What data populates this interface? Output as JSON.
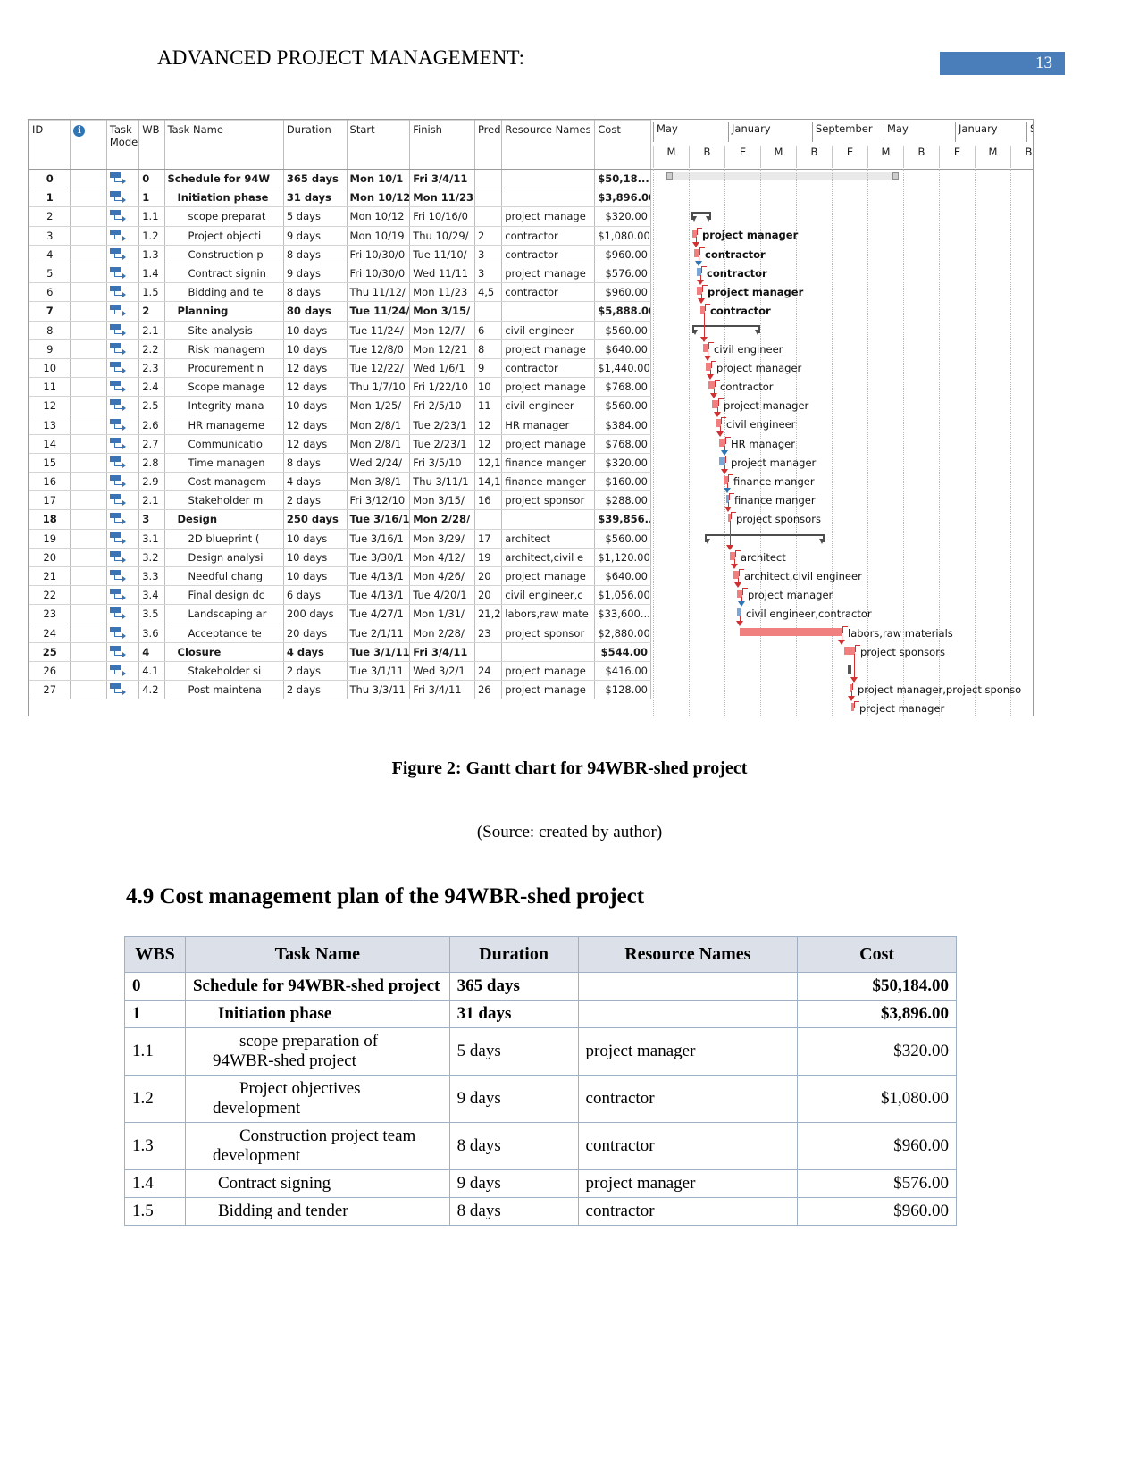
{
  "header": {
    "title": "ADVANCED PROJECT MANAGEMENT:",
    "page_number": "13",
    "badge_color": "#4A7EBB"
  },
  "gantt": {
    "columns": [
      "ID",
      "",
      "Task Mode",
      "WBS",
      "Task Name",
      "Duration",
      "Start",
      "Finish",
      "Pred",
      "Resource Names",
      "Cost"
    ],
    "column_labels": {
      "id": "ID",
      "info": "",
      "mode_line1": "Task",
      "mode_line2": "Mode",
      "wbs": "WB",
      "name": "Task Name",
      "duration": "Duration",
      "start": "Start",
      "finish": "Finish",
      "pred": "Pred",
      "resource": "Resource Names",
      "cost": "Cost"
    },
    "rows": [
      {
        "id": "0",
        "wbs": "0",
        "name": "Schedule for 94W",
        "duration": "365 days",
        "start": "Mon 10/1",
        "finish": "Fri 3/4/11",
        "pred": "",
        "resource": "",
        "cost": "$50,18...",
        "level": 0,
        "summary": true
      },
      {
        "id": "1",
        "wbs": "1",
        "name": "Initiation phase",
        "duration": "31 days",
        "start": "Mon 10/12",
        "finish": "Mon 11/23",
        "pred": "",
        "resource": "",
        "cost": "$3,896.00",
        "level": 1,
        "summary": true
      },
      {
        "id": "2",
        "wbs": "1.1",
        "name": "scope preparat",
        "duration": "5 days",
        "start": "Mon 10/12",
        "finish": "Fri 10/16/0",
        "pred": "",
        "resource": "project manage",
        "cost": "$320.00",
        "level": 2,
        "summary": false
      },
      {
        "id": "3",
        "wbs": "1.2",
        "name": "Project objecti",
        "duration": "9 days",
        "start": "Mon 10/19",
        "finish": "Thu 10/29/",
        "pred": "2",
        "resource": "contractor",
        "cost": "$1,080.00",
        "level": 2,
        "summary": false
      },
      {
        "id": "4",
        "wbs": "1.3",
        "name": "Construction p",
        "duration": "8 days",
        "start": "Fri 10/30/0",
        "finish": "Tue 11/10/",
        "pred": "3",
        "resource": "contractor",
        "cost": "$960.00",
        "level": 2,
        "summary": false
      },
      {
        "id": "5",
        "wbs": "1.4",
        "name": "Contract signin",
        "duration": "9 days",
        "start": "Fri 10/30/0",
        "finish": "Wed 11/11",
        "pred": "3",
        "resource": "project manage",
        "cost": "$576.00",
        "level": 2,
        "summary": false
      },
      {
        "id": "6",
        "wbs": "1.5",
        "name": "Bidding and te",
        "duration": "8 days",
        "start": "Thu 11/12/",
        "finish": "Mon 11/23",
        "pred": "4,5",
        "resource": "contractor",
        "cost": "$960.00",
        "level": 2,
        "summary": false
      },
      {
        "id": "7",
        "wbs": "2",
        "name": "Planning",
        "duration": "80 days",
        "start": "Tue 11/24/",
        "finish": "Mon 3/15/",
        "pred": "",
        "resource": "",
        "cost": "$5,888.00",
        "level": 1,
        "summary": true
      },
      {
        "id": "8",
        "wbs": "2.1",
        "name": "Site analysis",
        "duration": "10 days",
        "start": "Tue 11/24/",
        "finish": "Mon 12/7/",
        "pred": "6",
        "resource": "civil engineer",
        "cost": "$560.00",
        "level": 2,
        "summary": false
      },
      {
        "id": "9",
        "wbs": "2.2",
        "name": "Risk managem",
        "duration": "10 days",
        "start": "Tue 12/8/0",
        "finish": "Mon 12/21",
        "pred": "8",
        "resource": "project manage",
        "cost": "$640.00",
        "level": 2,
        "summary": false
      },
      {
        "id": "10",
        "wbs": "2.3",
        "name": "Procurement n",
        "duration": "12 days",
        "start": "Tue 12/22/",
        "finish": "Wed 1/6/1",
        "pred": "9",
        "resource": "contractor",
        "cost": "$1,440.00",
        "level": 2,
        "summary": false
      },
      {
        "id": "11",
        "wbs": "2.4",
        "name": "Scope manage",
        "duration": "12 days",
        "start": "Thu 1/7/10",
        "finish": "Fri 1/22/10",
        "pred": "10",
        "resource": "project manage",
        "cost": "$768.00",
        "level": 2,
        "summary": false
      },
      {
        "id": "12",
        "wbs": "2.5",
        "name": "Integrity mana",
        "duration": "10 days",
        "start": "Mon 1/25/",
        "finish": "Fri 2/5/10",
        "pred": "11",
        "resource": "civil engineer",
        "cost": "$560.00",
        "level": 2,
        "summary": false
      },
      {
        "id": "13",
        "wbs": "2.6",
        "name": "HR manageme",
        "duration": "12 days",
        "start": "Mon 2/8/1",
        "finish": "Tue 2/23/1",
        "pred": "12",
        "resource": "HR manager",
        "cost": "$384.00",
        "level": 2,
        "summary": false
      },
      {
        "id": "14",
        "wbs": "2.7",
        "name": "Communicatio",
        "duration": "12 days",
        "start": "Mon 2/8/1",
        "finish": "Tue 2/23/1",
        "pred": "12",
        "resource": "project manage",
        "cost": "$768.00",
        "level": 2,
        "summary": false
      },
      {
        "id": "15",
        "wbs": "2.8",
        "name": "Time managen",
        "duration": "8 days",
        "start": "Wed 2/24/",
        "finish": "Fri 3/5/10",
        "pred": "12,1",
        "resource": "finance manger",
        "cost": "$320.00",
        "level": 2,
        "summary": false
      },
      {
        "id": "16",
        "wbs": "2.9",
        "name": "Cost managem",
        "duration": "4 days",
        "start": "Mon 3/8/1",
        "finish": "Thu 3/11/1",
        "pred": "14,1",
        "resource": "finance manger",
        "cost": "$160.00",
        "level": 2,
        "summary": false
      },
      {
        "id": "17",
        "wbs": "2.1",
        "name": "Stakeholder m",
        "duration": "2 days",
        "start": "Fri 3/12/10",
        "finish": "Mon 3/15/",
        "pred": "16",
        "resource": "project sponsor",
        "cost": "$288.00",
        "level": 2,
        "summary": false
      },
      {
        "id": "18",
        "wbs": "3",
        "name": "Design",
        "duration": "250 days",
        "start": "Tue 3/16/1",
        "finish": "Mon 2/28/",
        "pred": "",
        "resource": "",
        "cost": "$39,856...",
        "level": 1,
        "summary": true
      },
      {
        "id": "19",
        "wbs": "3.1",
        "name": "2D blueprint (",
        "duration": "10 days",
        "start": "Tue 3/16/1",
        "finish": "Mon 3/29/",
        "pred": "17",
        "resource": "architect",
        "cost": "$560.00",
        "level": 2,
        "summary": false
      },
      {
        "id": "20",
        "wbs": "3.2",
        "name": "Design analysi",
        "duration": "10 days",
        "start": "Tue 3/30/1",
        "finish": "Mon 4/12/",
        "pred": "19",
        "resource": "architect,civil e",
        "cost": "$1,120.00",
        "level": 2,
        "summary": false
      },
      {
        "id": "21",
        "wbs": "3.3",
        "name": "Needful chang",
        "duration": "10 days",
        "start": "Tue 4/13/1",
        "finish": "Mon 4/26/",
        "pred": "20",
        "resource": "project manage",
        "cost": "$640.00",
        "level": 2,
        "summary": false
      },
      {
        "id": "22",
        "wbs": "3.4",
        "name": "Final design dc",
        "duration": "6 days",
        "start": "Tue 4/13/1",
        "finish": "Tue 4/20/1",
        "pred": "20",
        "resource": "civil engineer,c",
        "cost": "$1,056.00",
        "level": 2,
        "summary": false
      },
      {
        "id": "23",
        "wbs": "3.5",
        "name": "Landscaping ar",
        "duration": "200 days",
        "start": "Tue 4/27/1",
        "finish": "Mon 1/31/",
        "pred": "21,2",
        "resource": "labors,raw mate",
        "cost": "$33,600...",
        "level": 2,
        "summary": false
      },
      {
        "id": "24",
        "wbs": "3.6",
        "name": "Acceptance te",
        "duration": "20 days",
        "start": "Tue 2/1/11",
        "finish": "Mon 2/28/",
        "pred": "23",
        "resource": "project sponsor",
        "cost": "$2,880.00",
        "level": 2,
        "summary": false
      },
      {
        "id": "25",
        "wbs": "4",
        "name": "Closure",
        "duration": "4 days",
        "start": "Tue 3/1/11",
        "finish": "Fri 3/4/11",
        "pred": "",
        "resource": "",
        "cost": "$544.00",
        "level": 1,
        "summary": true
      },
      {
        "id": "26",
        "wbs": "4.1",
        "name": "Stakeholder si",
        "duration": "2 days",
        "start": "Tue 3/1/11",
        "finish": "Wed 3/2/1",
        "pred": "24",
        "resource": "project manage",
        "cost": "$416.00",
        "level": 2,
        "summary": false
      },
      {
        "id": "27",
        "wbs": "4.2",
        "name": "Post maintena",
        "duration": "2 days",
        "start": "Thu 3/3/11",
        "finish": "Fri 3/4/11",
        "pred": "26",
        "resource": "project manage",
        "cost": "$128.00",
        "level": 2,
        "summary": false
      }
    ],
    "timeline": {
      "major_labels": [
        "May",
        "January",
        "September",
        "May",
        "January",
        "S"
      ],
      "minor_labels": [
        "M",
        "B",
        "E",
        "M",
        "B",
        "E",
        "M",
        "B",
        "E",
        "M",
        "B"
      ]
    },
    "bar_labels": [
      "project manager",
      "contractor",
      "contractor",
      "project manager",
      "contractor",
      "civil engineer",
      "project manager",
      "contractor",
      "project manager",
      "civil engineer",
      "HR manager",
      "project manager",
      "finance manger",
      "finance manger",
      "project sponsors",
      "architect",
      "architect,civil engineer",
      "project manager",
      "civil engineer,contractor",
      "labors,raw materials",
      "project sponsors",
      "project manager,project sponso",
      "project manager"
    ]
  },
  "figure": {
    "caption": "Figure 2: Gantt chart for 94WBR-shed project",
    "source": "(Source: created by author)"
  },
  "section": {
    "heading": "4.9 Cost management plan of the 94WBR-shed project"
  },
  "cost_table": {
    "headers": [
      "WBS",
      "Task Name",
      "Duration",
      "Resource Names",
      "Cost"
    ],
    "rows": [
      {
        "wbs": "0",
        "name": "Schedule for 94WBR-shed project",
        "duration": "365 days",
        "resource": "",
        "cost": "$50,184.00",
        "bold": true,
        "indent": 0
      },
      {
        "wbs": "1",
        "name": "Initiation phase",
        "duration": "31 days",
        "resource": "",
        "cost": "$3,896.00",
        "bold": true,
        "indent": 1
      },
      {
        "wbs": "1.1",
        "name": "scope preparation of 94WBR-shed project",
        "duration": "5 days",
        "resource": "project manager",
        "cost": "$320.00",
        "bold": false,
        "indent": 2
      },
      {
        "wbs": "1.2",
        "name": "Project objectives development",
        "duration": "9 days",
        "resource": "contractor",
        "cost": "$1,080.00",
        "bold": false,
        "indent": 2
      },
      {
        "wbs": "1.3",
        "name": "Construction project team development",
        "duration": "8 days",
        "resource": "contractor",
        "cost": "$960.00",
        "bold": false,
        "indent": 2
      },
      {
        "wbs": "1.4",
        "name": "Contract signing",
        "duration": "9 days",
        "resource": "project manager",
        "cost": "$576.00",
        "bold": false,
        "indent": 1
      },
      {
        "wbs": "1.5",
        "name": "Bidding and tender",
        "duration": "8 days",
        "resource": "contractor",
        "cost": "$960.00",
        "bold": false,
        "indent": 1
      }
    ]
  }
}
